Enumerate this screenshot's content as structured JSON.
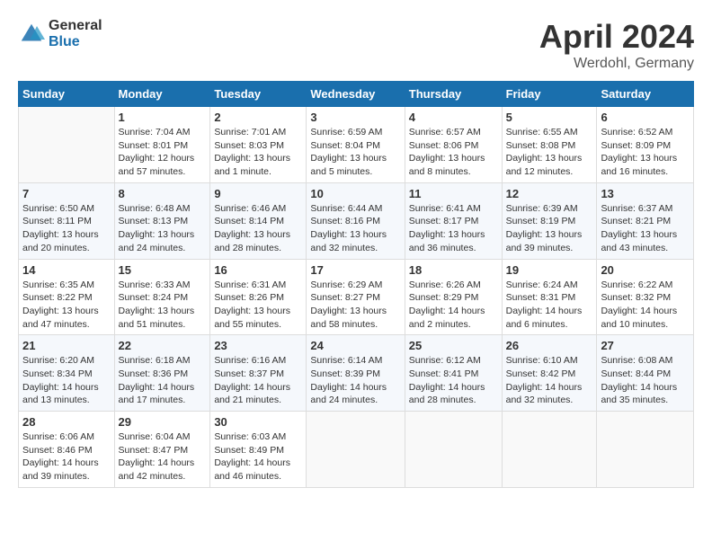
{
  "header": {
    "logo_general": "General",
    "logo_blue": "Blue",
    "title": "April 2024",
    "location": "Werdohl, Germany"
  },
  "days_of_week": [
    "Sunday",
    "Monday",
    "Tuesday",
    "Wednesday",
    "Thursday",
    "Friday",
    "Saturday"
  ],
  "weeks": [
    [
      {
        "day": "",
        "sunrise": "",
        "sunset": "",
        "daylight": ""
      },
      {
        "day": "1",
        "sunrise": "Sunrise: 7:04 AM",
        "sunset": "Sunset: 8:01 PM",
        "daylight": "Daylight: 12 hours and 57 minutes."
      },
      {
        "day": "2",
        "sunrise": "Sunrise: 7:01 AM",
        "sunset": "Sunset: 8:03 PM",
        "daylight": "Daylight: 13 hours and 1 minute."
      },
      {
        "day": "3",
        "sunrise": "Sunrise: 6:59 AM",
        "sunset": "Sunset: 8:04 PM",
        "daylight": "Daylight: 13 hours and 5 minutes."
      },
      {
        "day": "4",
        "sunrise": "Sunrise: 6:57 AM",
        "sunset": "Sunset: 8:06 PM",
        "daylight": "Daylight: 13 hours and 8 minutes."
      },
      {
        "day": "5",
        "sunrise": "Sunrise: 6:55 AM",
        "sunset": "Sunset: 8:08 PM",
        "daylight": "Daylight: 13 hours and 12 minutes."
      },
      {
        "day": "6",
        "sunrise": "Sunrise: 6:52 AM",
        "sunset": "Sunset: 8:09 PM",
        "daylight": "Daylight: 13 hours and 16 minutes."
      }
    ],
    [
      {
        "day": "7",
        "sunrise": "Sunrise: 6:50 AM",
        "sunset": "Sunset: 8:11 PM",
        "daylight": "Daylight: 13 hours and 20 minutes."
      },
      {
        "day": "8",
        "sunrise": "Sunrise: 6:48 AM",
        "sunset": "Sunset: 8:13 PM",
        "daylight": "Daylight: 13 hours and 24 minutes."
      },
      {
        "day": "9",
        "sunrise": "Sunrise: 6:46 AM",
        "sunset": "Sunset: 8:14 PM",
        "daylight": "Daylight: 13 hours and 28 minutes."
      },
      {
        "day": "10",
        "sunrise": "Sunrise: 6:44 AM",
        "sunset": "Sunset: 8:16 PM",
        "daylight": "Daylight: 13 hours and 32 minutes."
      },
      {
        "day": "11",
        "sunrise": "Sunrise: 6:41 AM",
        "sunset": "Sunset: 8:17 PM",
        "daylight": "Daylight: 13 hours and 36 minutes."
      },
      {
        "day": "12",
        "sunrise": "Sunrise: 6:39 AM",
        "sunset": "Sunset: 8:19 PM",
        "daylight": "Daylight: 13 hours and 39 minutes."
      },
      {
        "day": "13",
        "sunrise": "Sunrise: 6:37 AM",
        "sunset": "Sunset: 8:21 PM",
        "daylight": "Daylight: 13 hours and 43 minutes."
      }
    ],
    [
      {
        "day": "14",
        "sunrise": "Sunrise: 6:35 AM",
        "sunset": "Sunset: 8:22 PM",
        "daylight": "Daylight: 13 hours and 47 minutes."
      },
      {
        "day": "15",
        "sunrise": "Sunrise: 6:33 AM",
        "sunset": "Sunset: 8:24 PM",
        "daylight": "Daylight: 13 hours and 51 minutes."
      },
      {
        "day": "16",
        "sunrise": "Sunrise: 6:31 AM",
        "sunset": "Sunset: 8:26 PM",
        "daylight": "Daylight: 13 hours and 55 minutes."
      },
      {
        "day": "17",
        "sunrise": "Sunrise: 6:29 AM",
        "sunset": "Sunset: 8:27 PM",
        "daylight": "Daylight: 13 hours and 58 minutes."
      },
      {
        "day": "18",
        "sunrise": "Sunrise: 6:26 AM",
        "sunset": "Sunset: 8:29 PM",
        "daylight": "Daylight: 14 hours and 2 minutes."
      },
      {
        "day": "19",
        "sunrise": "Sunrise: 6:24 AM",
        "sunset": "Sunset: 8:31 PM",
        "daylight": "Daylight: 14 hours and 6 minutes."
      },
      {
        "day": "20",
        "sunrise": "Sunrise: 6:22 AM",
        "sunset": "Sunset: 8:32 PM",
        "daylight": "Daylight: 14 hours and 10 minutes."
      }
    ],
    [
      {
        "day": "21",
        "sunrise": "Sunrise: 6:20 AM",
        "sunset": "Sunset: 8:34 PM",
        "daylight": "Daylight: 14 hours and 13 minutes."
      },
      {
        "day": "22",
        "sunrise": "Sunrise: 6:18 AM",
        "sunset": "Sunset: 8:36 PM",
        "daylight": "Daylight: 14 hours and 17 minutes."
      },
      {
        "day": "23",
        "sunrise": "Sunrise: 6:16 AM",
        "sunset": "Sunset: 8:37 PM",
        "daylight": "Daylight: 14 hours and 21 minutes."
      },
      {
        "day": "24",
        "sunrise": "Sunrise: 6:14 AM",
        "sunset": "Sunset: 8:39 PM",
        "daylight": "Daylight: 14 hours and 24 minutes."
      },
      {
        "day": "25",
        "sunrise": "Sunrise: 6:12 AM",
        "sunset": "Sunset: 8:41 PM",
        "daylight": "Daylight: 14 hours and 28 minutes."
      },
      {
        "day": "26",
        "sunrise": "Sunrise: 6:10 AM",
        "sunset": "Sunset: 8:42 PM",
        "daylight": "Daylight: 14 hours and 32 minutes."
      },
      {
        "day": "27",
        "sunrise": "Sunrise: 6:08 AM",
        "sunset": "Sunset: 8:44 PM",
        "daylight": "Daylight: 14 hours and 35 minutes."
      }
    ],
    [
      {
        "day": "28",
        "sunrise": "Sunrise: 6:06 AM",
        "sunset": "Sunset: 8:46 PM",
        "daylight": "Daylight: 14 hours and 39 minutes."
      },
      {
        "day": "29",
        "sunrise": "Sunrise: 6:04 AM",
        "sunset": "Sunset: 8:47 PM",
        "daylight": "Daylight: 14 hours and 42 minutes."
      },
      {
        "day": "30",
        "sunrise": "Sunrise: 6:03 AM",
        "sunset": "Sunset: 8:49 PM",
        "daylight": "Daylight: 14 hours and 46 minutes."
      },
      {
        "day": "",
        "sunrise": "",
        "sunset": "",
        "daylight": ""
      },
      {
        "day": "",
        "sunrise": "",
        "sunset": "",
        "daylight": ""
      },
      {
        "day": "",
        "sunrise": "",
        "sunset": "",
        "daylight": ""
      },
      {
        "day": "",
        "sunrise": "",
        "sunset": "",
        "daylight": ""
      }
    ]
  ]
}
